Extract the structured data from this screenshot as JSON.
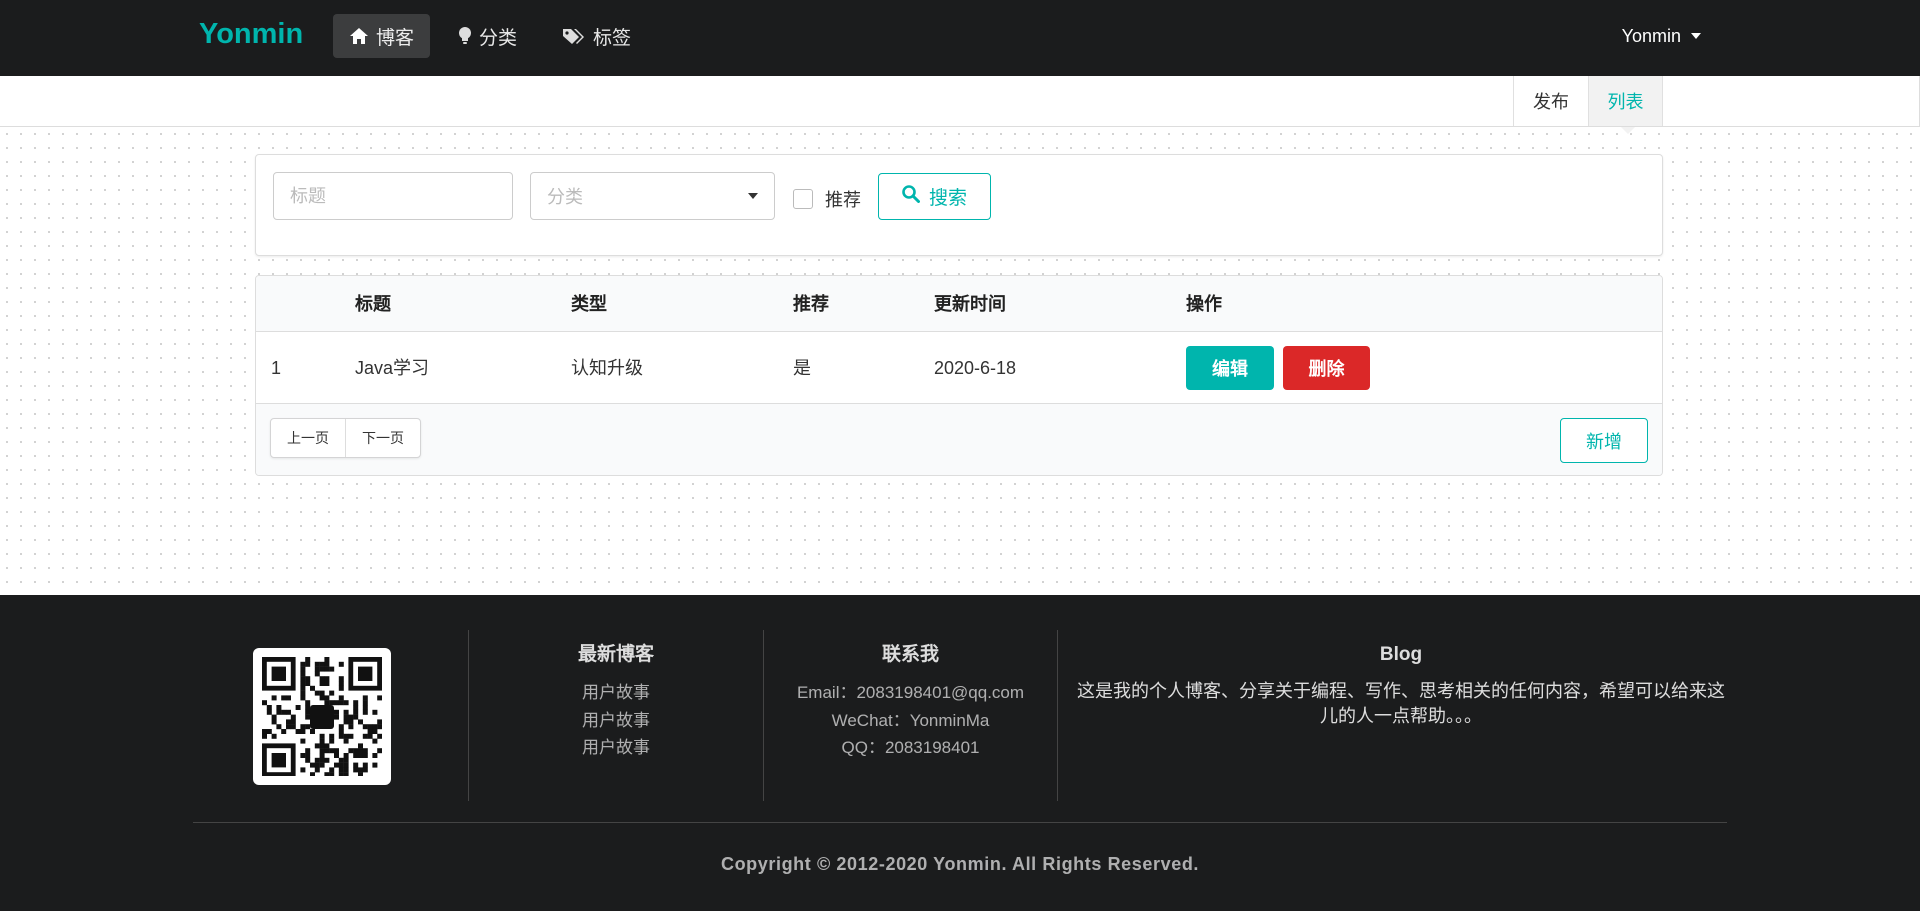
{
  "navbar": {
    "brand": "Yonmin",
    "items": [
      {
        "label": "博客",
        "icon": "home-icon",
        "active": true
      },
      {
        "label": "分类",
        "icon": "lightbulb-icon",
        "active": false
      },
      {
        "label": "标签",
        "icon": "tags-icon",
        "active": false
      }
    ],
    "user": "Yonmin"
  },
  "submenu": {
    "publish": "发布",
    "list": "列表"
  },
  "search": {
    "title_placeholder": "标题",
    "category_placeholder": "分类",
    "recommend_label": "推荐",
    "search_label": "搜索"
  },
  "table": {
    "headers": [
      "",
      "标题",
      "类型",
      "推荐",
      "更新时间",
      "操作"
    ],
    "rows": [
      {
        "id": "1",
        "title": "Java学习",
        "type": "认知升级",
        "recommend": "是",
        "updated": "2020-6-18"
      }
    ],
    "edit_label": "编辑",
    "delete_label": "删除",
    "prev_label": "上一页",
    "next_label": "下一页",
    "add_label": "新增"
  },
  "footer": {
    "latest": {
      "title": "最新博客",
      "items": [
        "用户故事",
        "用户故事",
        "用户故事"
      ]
    },
    "contact": {
      "title": "联系我",
      "email": "Email：2083198401@qq.com",
      "wechat": "WeChat：YonminMa",
      "qq": "QQ：2083198401"
    },
    "blog": {
      "title": "Blog",
      "description": "这是我的个人博客、分享关于编程、写作、思考相关的任何内容，希望可以给来这儿的人一点帮助。。。"
    },
    "copyright": "Copyright © 2012-2020 Yonmin. All Rights Reserved."
  },
  "colors": {
    "accent": "#00b5ad",
    "danger": "#db2828",
    "dark": "#1b1c1d"
  }
}
